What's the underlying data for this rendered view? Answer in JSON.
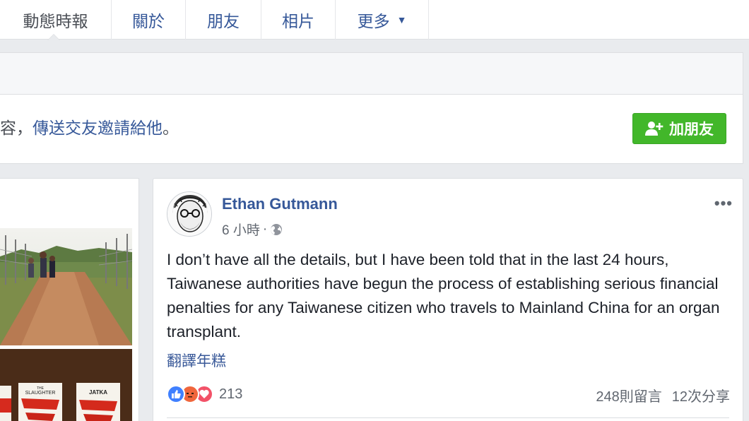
{
  "tabs": [
    {
      "label": "動態時報"
    },
    {
      "label": "關於"
    },
    {
      "label": "朋友"
    },
    {
      "label": "相片"
    },
    {
      "label": "更多"
    }
  ],
  "friend_request": {
    "prefix": "容，",
    "link": "傳送交友邀請給他",
    "suffix": "。",
    "button_label": "加朋友"
  },
  "post": {
    "author": "Ethan Gutmann",
    "time": "6 小時",
    "separator": "·",
    "text": "I don’t have all the details, but I have been told that in the last 24 hours, Taiwanese authorities have begun the process of establishing serious financial penalties for any Taiwanese citizen who travels to Mainland China for an organ transplant.",
    "translate": "翻譯年糕",
    "reaction_count": "213",
    "comments": "248則留言",
    "shares": "12次分享"
  },
  "book_labels": [
    "SLAUGHTER",
    "JATKA"
  ],
  "colors": {
    "link": "#365899",
    "add_friend": "#42b72a",
    "like": "#4080ff",
    "angry": "#f0663c",
    "love": "#f25268"
  },
  "icons": {
    "more_caret": "caret-down-icon",
    "add_friend": "add-person-icon",
    "privacy": "globe-icon",
    "options": "more-options-icon"
  }
}
